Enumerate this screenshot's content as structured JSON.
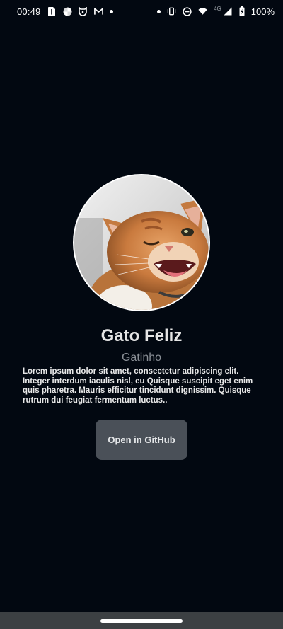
{
  "status_bar": {
    "time": "00:49",
    "network_label": "4G",
    "battery_percent": "100%",
    "left_icons": [
      "sim-card-alert-icon",
      "pinwheel-app-icon",
      "shield-app-icon",
      "gmail-icon",
      "dot-notification-icon"
    ],
    "right_icons": [
      "dot-icon",
      "vibrate-icon",
      "do-not-disturb-icon",
      "wifi-icon",
      "cell-signal-icon",
      "battery-charging-icon"
    ]
  },
  "profile": {
    "name": "Gato Feliz",
    "subtitle": "Gatinho",
    "bio": "Lorem ipsum dolor sit amet, consectetur adipiscing elit. Integer interdum iaculis nisl, eu  Quisque suscipit eget enim quis pharetra. Mauris efficitur tincidunt dignissim. Quisque rutrum dui feugiat fermentum luctus..",
    "avatar_alt": "cat-photo"
  },
  "actions": {
    "github_button_label": "Open in GitHub"
  },
  "colors": {
    "background": "#020811",
    "button": "#4a5058",
    "nav_bar": "#3c4043"
  }
}
